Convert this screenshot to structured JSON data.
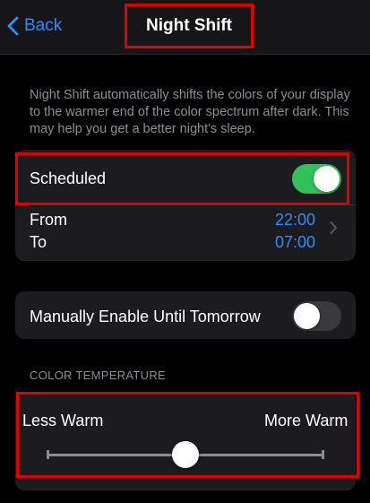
{
  "nav": {
    "back_label": "Back",
    "title": "Night Shift"
  },
  "description": "Night Shift automatically shifts the colors of your display to the warmer end of the color spectrum after dark. This may help you get a better night's sleep.",
  "schedule": {
    "scheduled_label": "Scheduled",
    "scheduled_on": true,
    "from_label": "From",
    "to_label": "To",
    "from_time": "22:00",
    "to_time": "07:00"
  },
  "manual": {
    "label": "Manually Enable Until Tomorrow",
    "on": false
  },
  "color_temperature": {
    "header": "COLOR TEMPERATURE",
    "min_label": "Less Warm",
    "max_label": "More Warm",
    "value": 0.5
  },
  "colors": {
    "accent": "#2f8cff",
    "toggle_on": "#30c259",
    "highlight": "#e00000"
  }
}
